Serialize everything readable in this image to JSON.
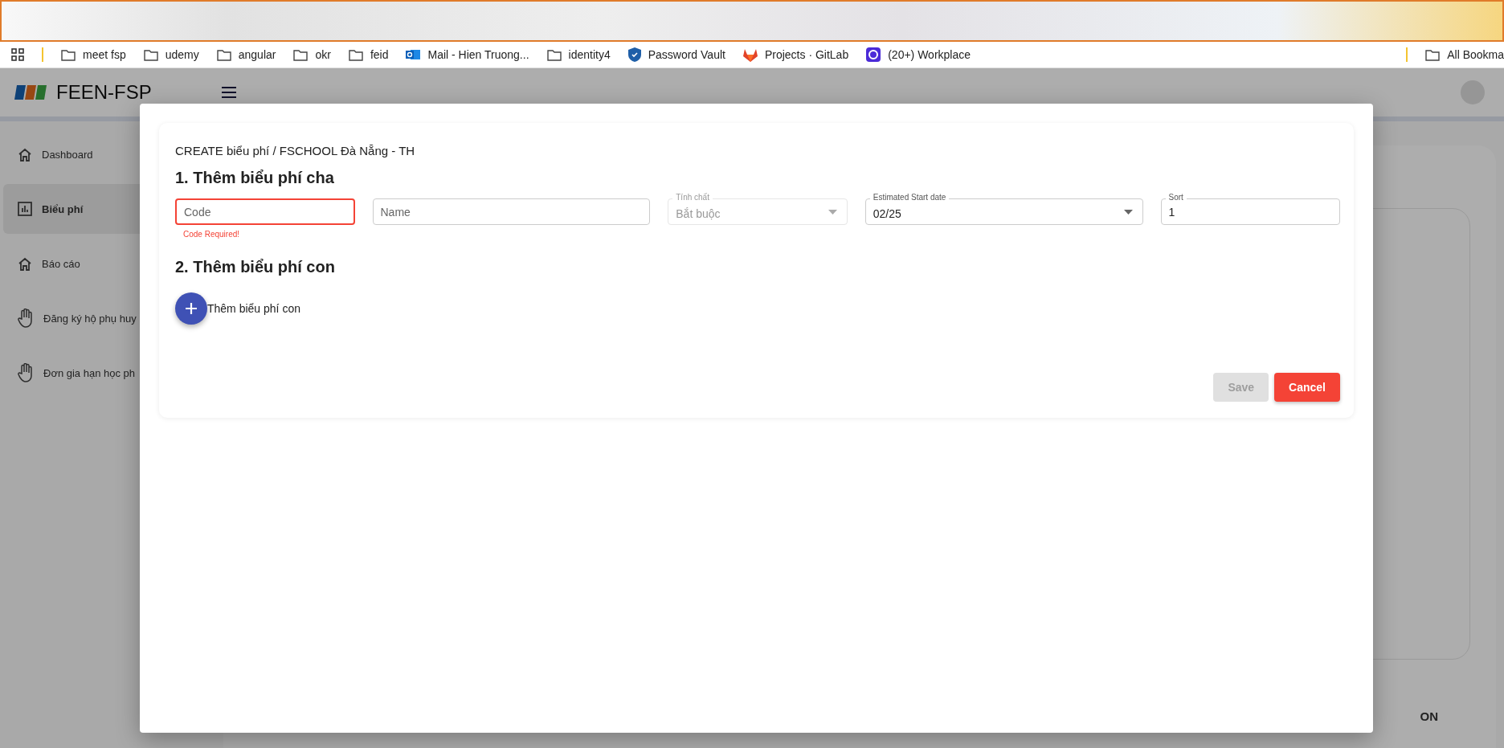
{
  "browser": {
    "bookmarks": [
      {
        "label": "meet fsp",
        "kind": "folder"
      },
      {
        "label": "udemy",
        "kind": "folder"
      },
      {
        "label": "angular",
        "kind": "folder"
      },
      {
        "label": "okr",
        "kind": "folder"
      },
      {
        "label": "feid",
        "kind": "folder"
      },
      {
        "label": "Mail - Hien Truong...",
        "kind": "mail"
      },
      {
        "label": "identity4",
        "kind": "folder"
      },
      {
        "label": "Password Vault",
        "kind": "shield"
      },
      {
        "label": "Projects · GitLab",
        "kind": "fox"
      },
      {
        "label": "(20+) Workplace",
        "kind": "workplace"
      }
    ],
    "all_bookmarks": "All Bookma"
  },
  "app": {
    "title": "FEEN-FSP",
    "sidebar": [
      {
        "label": "Dashboard",
        "kind": "home",
        "selected": false
      },
      {
        "label": "Biểu phí",
        "kind": "chart",
        "selected": true
      },
      {
        "label": "Báo cáo",
        "kind": "home",
        "selected": false
      },
      {
        "label": "Đăng ký hộ phụ huy",
        "kind": "hand",
        "selected": false
      },
      {
        "label": "Đơn gia hạn học ph",
        "kind": "hand",
        "selected": false
      }
    ],
    "background_heading": "ON"
  },
  "dialog": {
    "breadcrumb": "CREATE biểu phí / FSCHOOL Đà Nẵng - TH",
    "section_1": "1. Thêm biểu phí cha",
    "fields": [
      {
        "kind": "text",
        "placeholder": "Code",
        "invalid": true,
        "error": "Code Required!"
      },
      {
        "kind": "text",
        "placeholder": "Name",
        "invalid": false
      },
      {
        "kind": "select",
        "label": "Tính chất",
        "value": "Bắt buộc",
        "disabled": true
      },
      {
        "kind": "select",
        "label": "Estimated Start date",
        "value": "02/25",
        "disabled": false
      },
      {
        "kind": "text",
        "label": "Sort",
        "value": "1",
        "invalid": false
      }
    ],
    "section_2": "2. Thêm biểu phí con",
    "add_child": "Thêm biểu phí con",
    "buttons": [
      {
        "label": "Save",
        "kind": "primary",
        "disabled": true
      },
      {
        "label": "Cancel",
        "kind": "danger",
        "disabled": false
      }
    ]
  }
}
